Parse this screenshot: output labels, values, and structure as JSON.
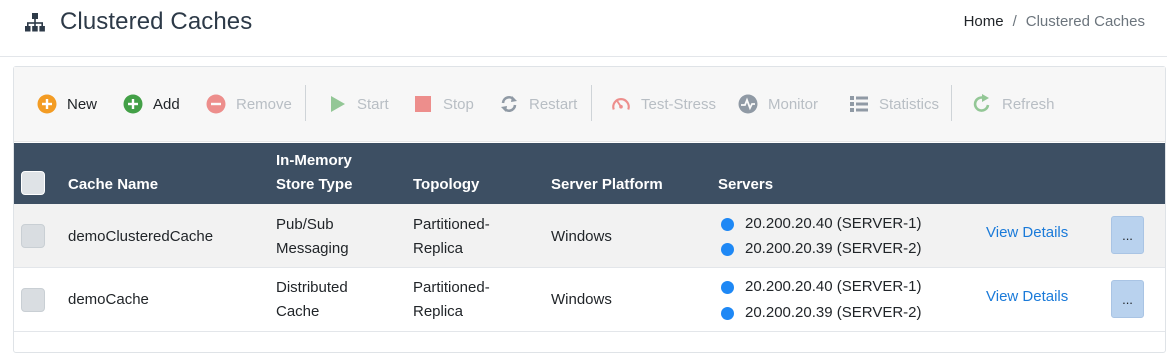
{
  "header": {
    "icon": "sitemap-icon",
    "title": "Clustered Caches",
    "breadcrumb": {
      "home": "Home",
      "separator": "/",
      "current": "Clustered Caches"
    }
  },
  "toolbar": {
    "new": "New",
    "add": "Add",
    "remove": "Remove",
    "start": "Start",
    "stop": "Stop",
    "restart": "Restart",
    "test_stress": "Test-Stress",
    "monitor": "Monitor",
    "statistics": "Statistics",
    "refresh": "Refresh"
  },
  "table": {
    "headers": {
      "cache_name": "Cache Name",
      "store_type_line1": "In-Memory",
      "store_type_line2": "Store Type",
      "topology": "Topology",
      "server_platform": "Server Platform",
      "servers": "Servers"
    },
    "rows": [
      {
        "cache_name": "demoClusteredCache",
        "store_type_line1": "Pub/Sub",
        "store_type_line2": "Messaging",
        "topology_line1": "Partitioned-",
        "topology_line2": "Replica",
        "platform": "Windows",
        "servers": [
          "20.200.20.40 (SERVER-1)",
          "20.200.20.39 (SERVER-2)"
        ],
        "view_details": "View Details",
        "more": "..."
      },
      {
        "cache_name": "demoCache",
        "store_type_line1": "Distributed",
        "store_type_line2": "Cache",
        "topology_line1": "Partitioned-",
        "topology_line2": "Replica",
        "platform": "Windows",
        "servers": [
          "20.200.20.40 (SERVER-1)",
          "20.200.20.39 (SERVER-2)"
        ],
        "view_details": "View Details",
        "more": "..."
      }
    ]
  },
  "colors": {
    "table_header_bg": "#3d4f63",
    "server_status": "#1e88f5",
    "link": "#1a7ad9",
    "more_button": "#b9d2ee",
    "new_icon": "#f39c24",
    "add_icon": "#43a047",
    "remove_icon": "#e53935"
  }
}
